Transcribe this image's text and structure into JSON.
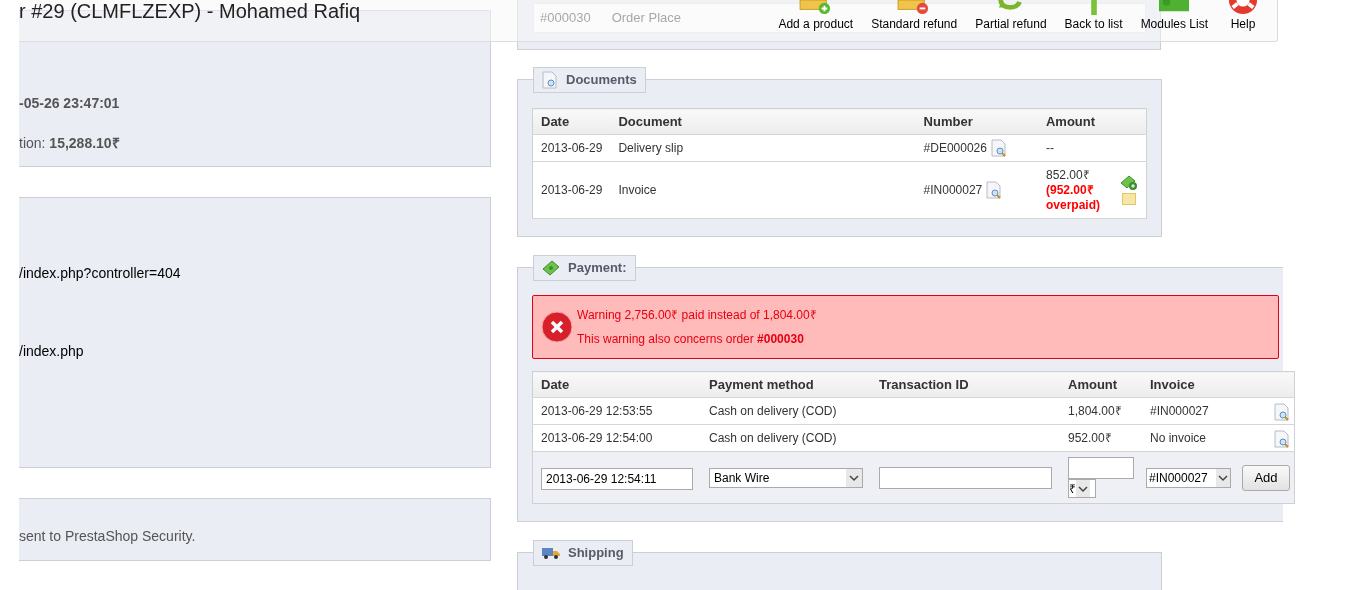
{
  "toolbar": {
    "title": "r #29 (CLMFLZEXP) - Mohamed Rafiq",
    "buttons": [
      {
        "kind": "add",
        "label": "Add a product"
      },
      {
        "kind": "remove",
        "label": "Standard refund"
      },
      {
        "kind": "refund",
        "label": "Partial refund"
      },
      {
        "kind": "back",
        "label": "Back to list"
      },
      {
        "kind": "modules",
        "label": "Modules List"
      },
      {
        "kind": "help",
        "label": "Help"
      }
    ]
  },
  "order_row": {
    "number": "#000030",
    "status": "Order Place"
  },
  "left_panels": [
    {
      "lines": [
        "**-05-26 23:47:01**",
        "tion: **15,288.10₹**"
      ]
    },
    {
      "lines": [
        "/index.php?controller=404",
        "/index.php"
      ]
    },
    {
      "lines": [
        "sent to PrestaShop Security."
      ]
    }
  ],
  "documents": {
    "title": "Documents",
    "columns": [
      "Date",
      "Document",
      "Number",
      "Amount"
    ],
    "rows": [
      {
        "date": "2013-06-29",
        "document": "Delivery slip",
        "number": "#DE000026",
        "amount": "--"
      },
      {
        "date": "2013-06-29",
        "document": "Invoice",
        "number": "#IN000027",
        "amount": "852.00₹",
        "note": "(952.00₹ overpaid)"
      }
    ]
  },
  "payment": {
    "title": "Payment:",
    "warning": [
      "Warning 2,756.00₹ paid instead of 1,804.00₹",
      "This warning also concerns order **#000030**"
    ],
    "columns": [
      "Date",
      "Payment method",
      "Transaction ID",
      "Amount",
      "Invoice"
    ],
    "rows": [
      {
        "date": "2013-06-29 12:53:55",
        "method": "Cash on delivery (COD)",
        "amount": "1,804.00₹",
        "invoice": "#IN000027"
      },
      {
        "date": "2013-06-29 12:54:00",
        "method": "Cash on delivery (COD)",
        "amount": "952.00₹",
        "invoice": "No invoice"
      }
    ],
    "form": {
      "date": "2013-06-29 12:54:11",
      "method": "Bank Wire",
      "currency": "₹",
      "invoice": "#IN000027",
      "button": "Add"
    }
  },
  "shipping": {
    "title": "Shipping"
  }
}
